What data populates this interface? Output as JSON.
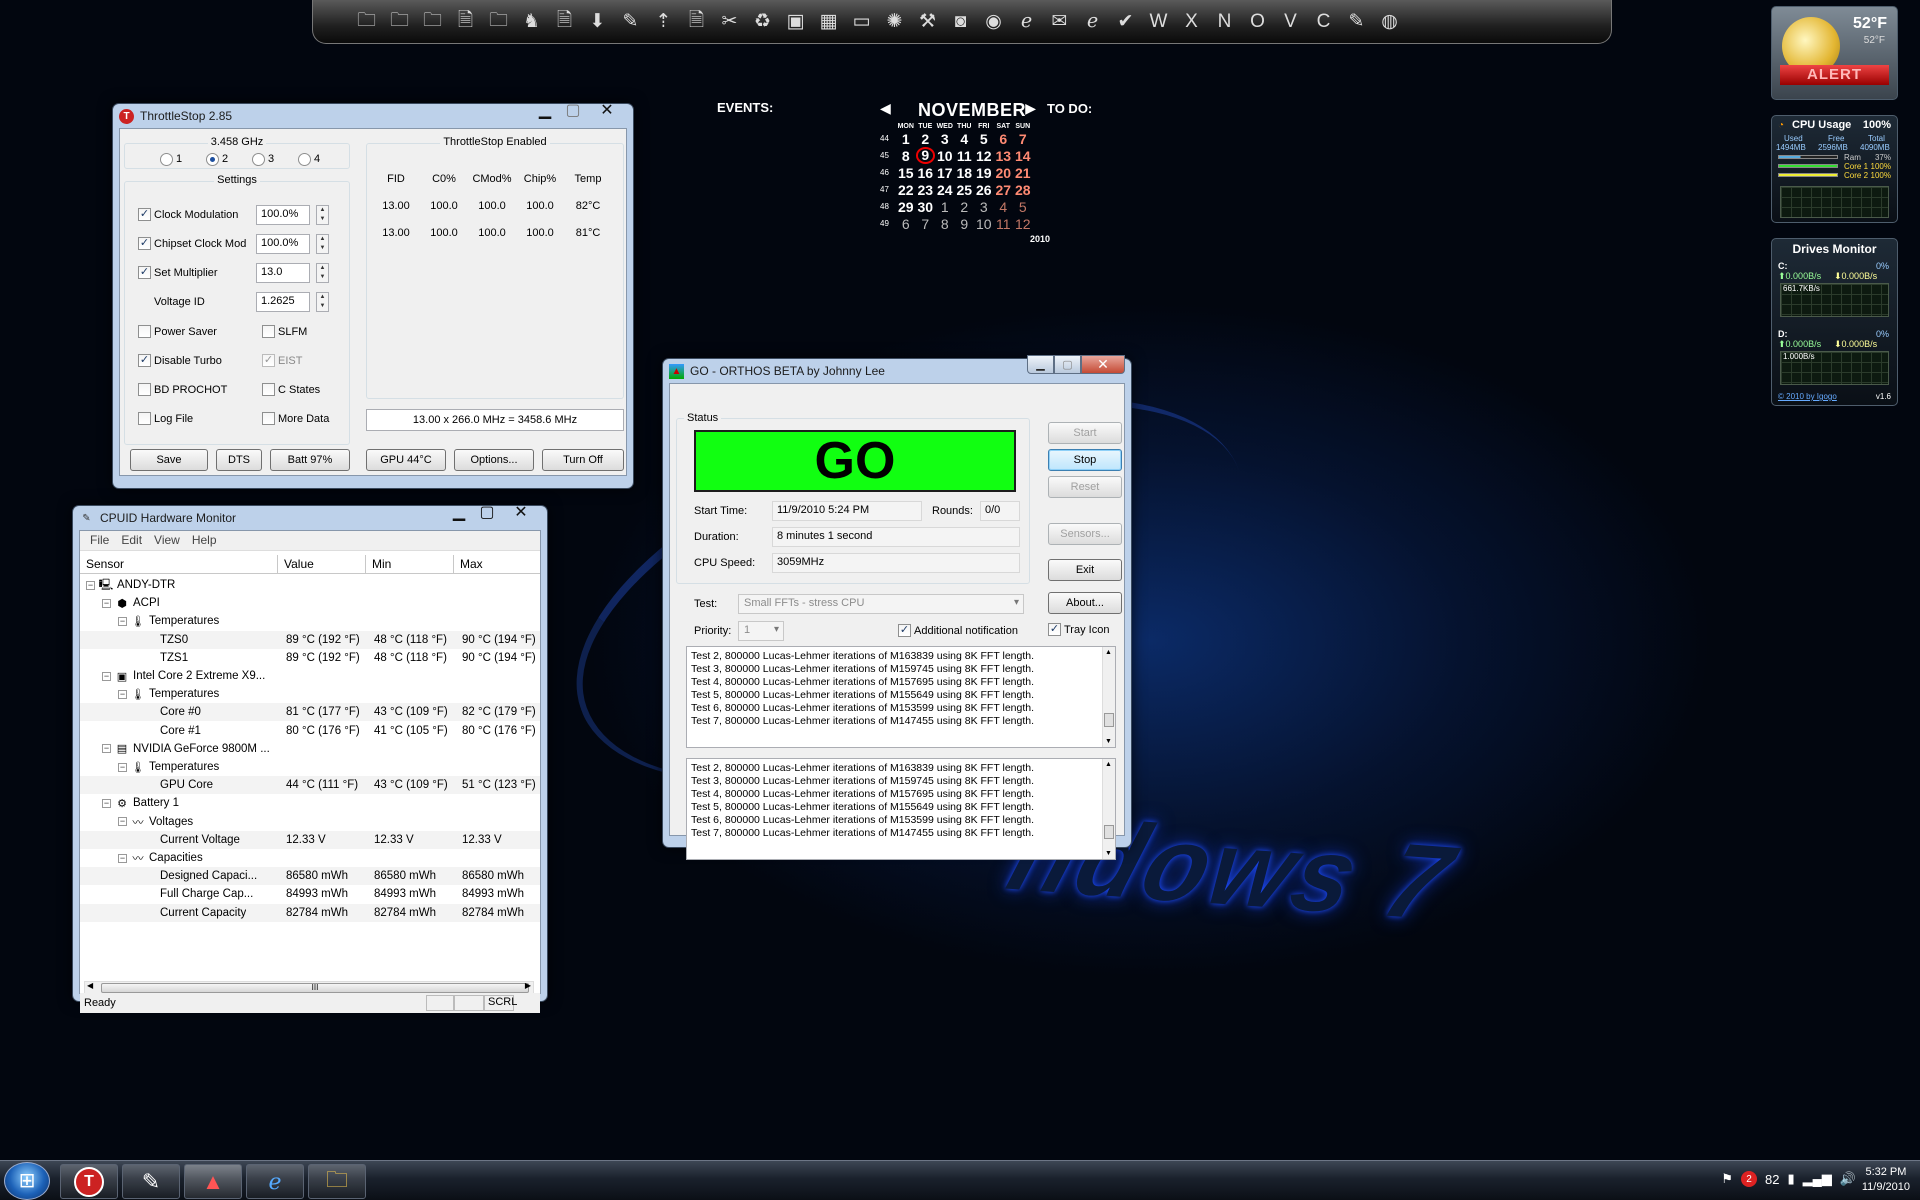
{
  "throttlestop": {
    "title": "ThrottleStop 2.85",
    "frequency": "3.458 GHz",
    "radios": [
      "1",
      "2",
      "3",
      "4"
    ],
    "settings_title": "Settings",
    "clock_modulation": {
      "label": "Clock Modulation",
      "value": "100.0%"
    },
    "chipset_clock_mod": {
      "label": "Chipset Clock Mod",
      "value": "100.0%"
    },
    "set_multiplier": {
      "label": "Set Multiplier",
      "value": "13.0"
    },
    "voltage_id": {
      "label": "Voltage ID",
      "value": "1.2625"
    },
    "power_saver": "Power Saver",
    "slfm": "SLFM",
    "disable_turbo": "Disable Turbo",
    "eist": "EIST",
    "bd_prochot": "BD PROCHOT",
    "c_states": "C States",
    "log_file": "Log File",
    "more_data": "More Data",
    "enabled_title": "ThrottleStop Enabled",
    "table_headers": [
      "FID",
      "C0%",
      "CMod%",
      "Chip%",
      "Temp"
    ],
    "table_rows": [
      [
        "13.00",
        "100.0",
        "100.0",
        "100.0",
        "82°C"
      ],
      [
        "13.00",
        "100.0",
        "100.0",
        "100.0",
        "81°C"
      ]
    ],
    "summary": "13.00 x 266.0 MHz = 3458.6 MHz",
    "buttons": {
      "save": "Save",
      "dts": "DTS",
      "batt": "Batt 97%",
      "gpu": "GPU 44°C",
      "options": "Options...",
      "turn_off": "Turn Off"
    }
  },
  "cpuid": {
    "title": "CPUID Hardware Monitor",
    "menu": [
      "File",
      "Edit",
      "View",
      "Help"
    ],
    "columns": [
      "Sensor",
      "Value",
      "Min",
      "Max"
    ],
    "rows": [
      {
        "name": "ANDY-DTR",
        "value": "",
        "min": "",
        "max": ""
      },
      {
        "name": "ACPI",
        "value": "",
        "min": "",
        "max": ""
      },
      {
        "name": "Temperatures",
        "value": "",
        "min": "",
        "max": ""
      },
      {
        "name": "TZS0",
        "value": "89 °C  (192 °F)",
        "min": "48 °C  (118 °F)",
        "max": "90 °C  (194 °F)"
      },
      {
        "name": "TZS1",
        "value": "89 °C  (192 °F)",
        "min": "48 °C  (118 °F)",
        "max": "90 °C  (194 °F)"
      },
      {
        "name": "Intel Core 2 Extreme X9...",
        "value": "",
        "min": "",
        "max": ""
      },
      {
        "name": "Temperatures",
        "value": "",
        "min": "",
        "max": ""
      },
      {
        "name": "Core #0",
        "value": "81 °C  (177 °F)",
        "min": "43 °C  (109 °F)",
        "max": "82 °C  (179 °F)"
      },
      {
        "name": "Core #1",
        "value": "80 °C  (176 °F)",
        "min": "41 °C  (105 °F)",
        "max": "80 °C  (176 °F)"
      },
      {
        "name": "NVIDIA GeForce 9800M ...",
        "value": "",
        "min": "",
        "max": ""
      },
      {
        "name": "Temperatures",
        "value": "",
        "min": "",
        "max": ""
      },
      {
        "name": "GPU Core",
        "value": "44 °C  (111 °F)",
        "min": "43 °C  (109 °F)",
        "max": "51 °C  (123 °F)"
      },
      {
        "name": "Battery 1",
        "value": "",
        "min": "",
        "max": ""
      },
      {
        "name": "Voltages",
        "value": "",
        "min": "",
        "max": ""
      },
      {
        "name": "Current Voltage",
        "value": "12.33 V",
        "min": "12.33 V",
        "max": "12.33 V"
      },
      {
        "name": "Capacities",
        "value": "",
        "min": "",
        "max": ""
      },
      {
        "name": "Designed Capaci...",
        "value": "86580 mWh",
        "min": "86580 mWh",
        "max": "86580 mWh"
      },
      {
        "name": "Full Charge Cap...",
        "value": "84993 mWh",
        "min": "84993 mWh",
        "max": "84993 mWh"
      },
      {
        "name": "Current Capacity",
        "value": "82784 mWh",
        "min": "82784 mWh",
        "max": "82784 mWh"
      }
    ],
    "status": "Ready",
    "scrl": "SCRL",
    "scroll_grip": "III"
  },
  "orthos": {
    "title": "GO - ORTHOS BETA by Johnny Lee",
    "status_label": "Status",
    "go_text": "GO",
    "go_color": "#11ff11",
    "start_time_label": "Start Time:",
    "start_time": "11/9/2010 5:24 PM",
    "rounds_label": "Rounds:",
    "rounds": "0/0",
    "duration_label": "Duration:",
    "duration": "8 minutes 1 second",
    "cpu_speed_label": "CPU Speed:",
    "cpu_speed": "3059MHz",
    "test_label": "Test:",
    "test_value": "Small FFTs - stress CPU",
    "priority_label": "Priority:",
    "priority_value": "1",
    "additional_notification": "Additional notification",
    "tray_icon": "Tray Icon",
    "buttons": {
      "start": "Start",
      "stop": "Stop",
      "reset": "Reset",
      "sensors": "Sensors...",
      "exit": "Exit",
      "about": "About..."
    },
    "log1": [
      "Test 2, 800000 Lucas-Lehmer iterations of M163839 using 8K FFT length.",
      "Test 3, 800000 Lucas-Lehmer iterations of M159745 using 8K FFT length.",
      "Test 4, 800000 Lucas-Lehmer iterations of M157695 using 8K FFT length.",
      "Test 5, 800000 Lucas-Lehmer iterations of M155649 using 8K FFT length.",
      "Test 6, 800000 Lucas-Lehmer iterations of M153599 using 8K FFT length.",
      "Test 7, 800000 Lucas-Lehmer iterations of M147455 using 8K FFT length."
    ],
    "log2": [
      "Test 2, 800000 Lucas-Lehmer iterations of M163839 using 8K FFT length.",
      "Test 3, 800000 Lucas-Lehmer iterations of M159745 using 8K FFT length.",
      "Test 4, 800000 Lucas-Lehmer iterations of M157695 using 8K FFT length.",
      "Test 5, 800000 Lucas-Lehmer iterations of M155649 using 8K FFT length.",
      "Test 6, 800000 Lucas-Lehmer iterations of M153599 using 8K FFT length.",
      "Test 7, 800000 Lucas-Lehmer iterations of M147455 using 8K FFT length."
    ]
  },
  "desktop": {
    "events_label": "EVENTS:",
    "todo_label": "TO DO:",
    "wallpaper_text": "ndows 7"
  },
  "calendar": {
    "month": "NOVEMBER",
    "year": "2010",
    "weekdays": [
      "MON",
      "TUE",
      "WED",
      "THU",
      "FRI",
      "SAT",
      "SUN"
    ],
    "weeks": [
      {
        "num": "44",
        "days": [
          "1",
          "2",
          "3",
          "4",
          "5",
          "6",
          "7"
        ]
      },
      {
        "num": "45",
        "days": [
          "8",
          "9",
          "10",
          "11",
          "12",
          "13",
          "14"
        ]
      },
      {
        "num": "46",
        "days": [
          "15",
          "16",
          "17",
          "18",
          "19",
          "20",
          "21"
        ]
      },
      {
        "num": "47",
        "days": [
          "22",
          "23",
          "24",
          "25",
          "26",
          "27",
          "28"
        ]
      },
      {
        "num": "48",
        "days": [
          "29",
          "30",
          "1",
          "2",
          "3",
          "4",
          "5"
        ]
      },
      {
        "num": "49",
        "days": [
          "6",
          "7",
          "8",
          "9",
          "10",
          "11",
          "12"
        ]
      }
    ],
    "today": "9"
  },
  "weather": {
    "temp": "52°F",
    "temp_small": "52°F",
    "alert": "ALERT"
  },
  "cpu_usage": {
    "title": "CPU Usage",
    "percent": "100%",
    "used_label": "Used",
    "free_label": "Free",
    "total_label": "Total",
    "used": "1494MB",
    "free": "2596MB",
    "total": "4090MB",
    "ram_label": "Ram",
    "ram": "37%",
    "core1_label": "Core 1",
    "core1": "100%",
    "core2_label": "Core 2",
    "core2": "100%"
  },
  "drives_monitor": {
    "title": "Drives Monitor",
    "c_label": "C:",
    "c_percent": "0%",
    "c_up": "0.000B/s",
    "c_down": "0.000B/s",
    "c_graph_label": "661.7KB/s",
    "d_label": "D:",
    "d_percent": "0%",
    "d_up": "0.000B/s",
    "d_down": "0.000B/s",
    "d_graph_label": "1.000B/s",
    "footer": "© 2010 by Igogo",
    "version": "v1.6"
  },
  "taskbar": {
    "tray_badge": "2",
    "tray_number": "82",
    "time": "5:32 PM",
    "date": "11/9/2010"
  },
  "dock_icons": [
    "folder-icon",
    "folder-icon",
    "folder-icon",
    "document-icon",
    "folder-icon",
    "chess-icon",
    "document-icon",
    "download-icon",
    "tools-icon",
    "rocket-icon",
    "document-icon",
    "tools-icon",
    "recycle-bin-icon",
    "photo-icon",
    "grid-icon",
    "monitor-icon",
    "film-icon",
    "tools-icon",
    "camera-icon",
    "chrome-icon",
    "ie-icon",
    "mail-icon",
    "ie-icon",
    "check-icon",
    "word-icon",
    "excel-icon",
    "onenote-icon",
    "office-icon",
    "vb-icon",
    "csharp-icon",
    "note-icon",
    "globe-icon"
  ]
}
